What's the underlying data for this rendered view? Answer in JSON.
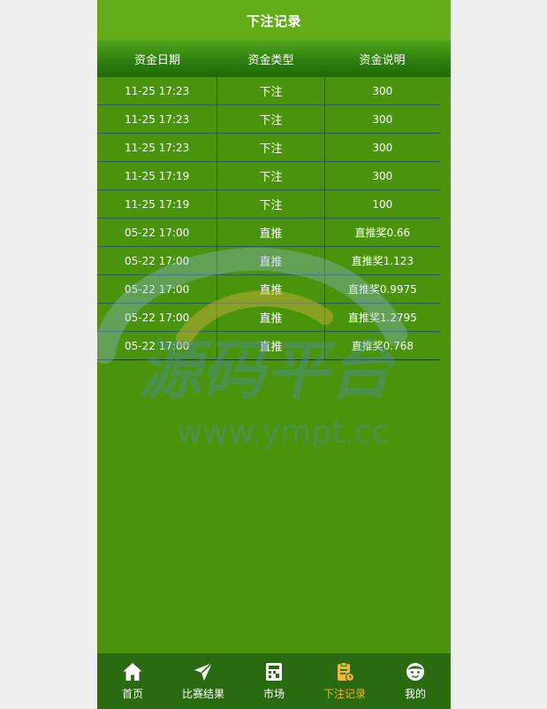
{
  "header": {
    "title": "下注记录"
  },
  "table": {
    "columns": [
      "资金日期",
      "资金类型",
      "资金说明"
    ],
    "rows": [
      {
        "date": "11-25 17:23",
        "type": "下注",
        "desc": "300"
      },
      {
        "date": "11-25 17:23",
        "type": "下注",
        "desc": "300"
      },
      {
        "date": "11-25 17:23",
        "type": "下注",
        "desc": "300"
      },
      {
        "date": "11-25 17:19",
        "type": "下注",
        "desc": "300"
      },
      {
        "date": "11-25 17:19",
        "type": "下注",
        "desc": "100"
      },
      {
        "date": "05-22 17:00",
        "type": "直推",
        "desc": "直推奖0.66"
      },
      {
        "date": "05-22 17:00",
        "type": "直推",
        "desc": "直推奖1.123"
      },
      {
        "date": "05-22 17:00",
        "type": "直推",
        "desc": "直推奖0.9975"
      },
      {
        "date": "05-22 17:00",
        "type": "直推",
        "desc": "直推奖1.2795"
      },
      {
        "date": "05-22 17:00",
        "type": "直推",
        "desc": "直推奖0.768"
      }
    ]
  },
  "watermark": {
    "brand": "源码平台",
    "url": "www.ympt.cc"
  },
  "tabbar": {
    "items": [
      {
        "label": "首页",
        "icon": "home-icon"
      },
      {
        "label": "比赛结果",
        "icon": "paper-plane-icon"
      },
      {
        "label": "市场",
        "icon": "market-icon"
      },
      {
        "label": "下注记录",
        "icon": "clipboard-icon",
        "active": true
      },
      {
        "label": "我的",
        "icon": "face-icon"
      }
    ]
  },
  "colors": {
    "page_bg": "#4a940b",
    "header_bg": "#62ac17",
    "tabbar_bg": "#2a6a10",
    "active_tab": "#f5b52e"
  }
}
